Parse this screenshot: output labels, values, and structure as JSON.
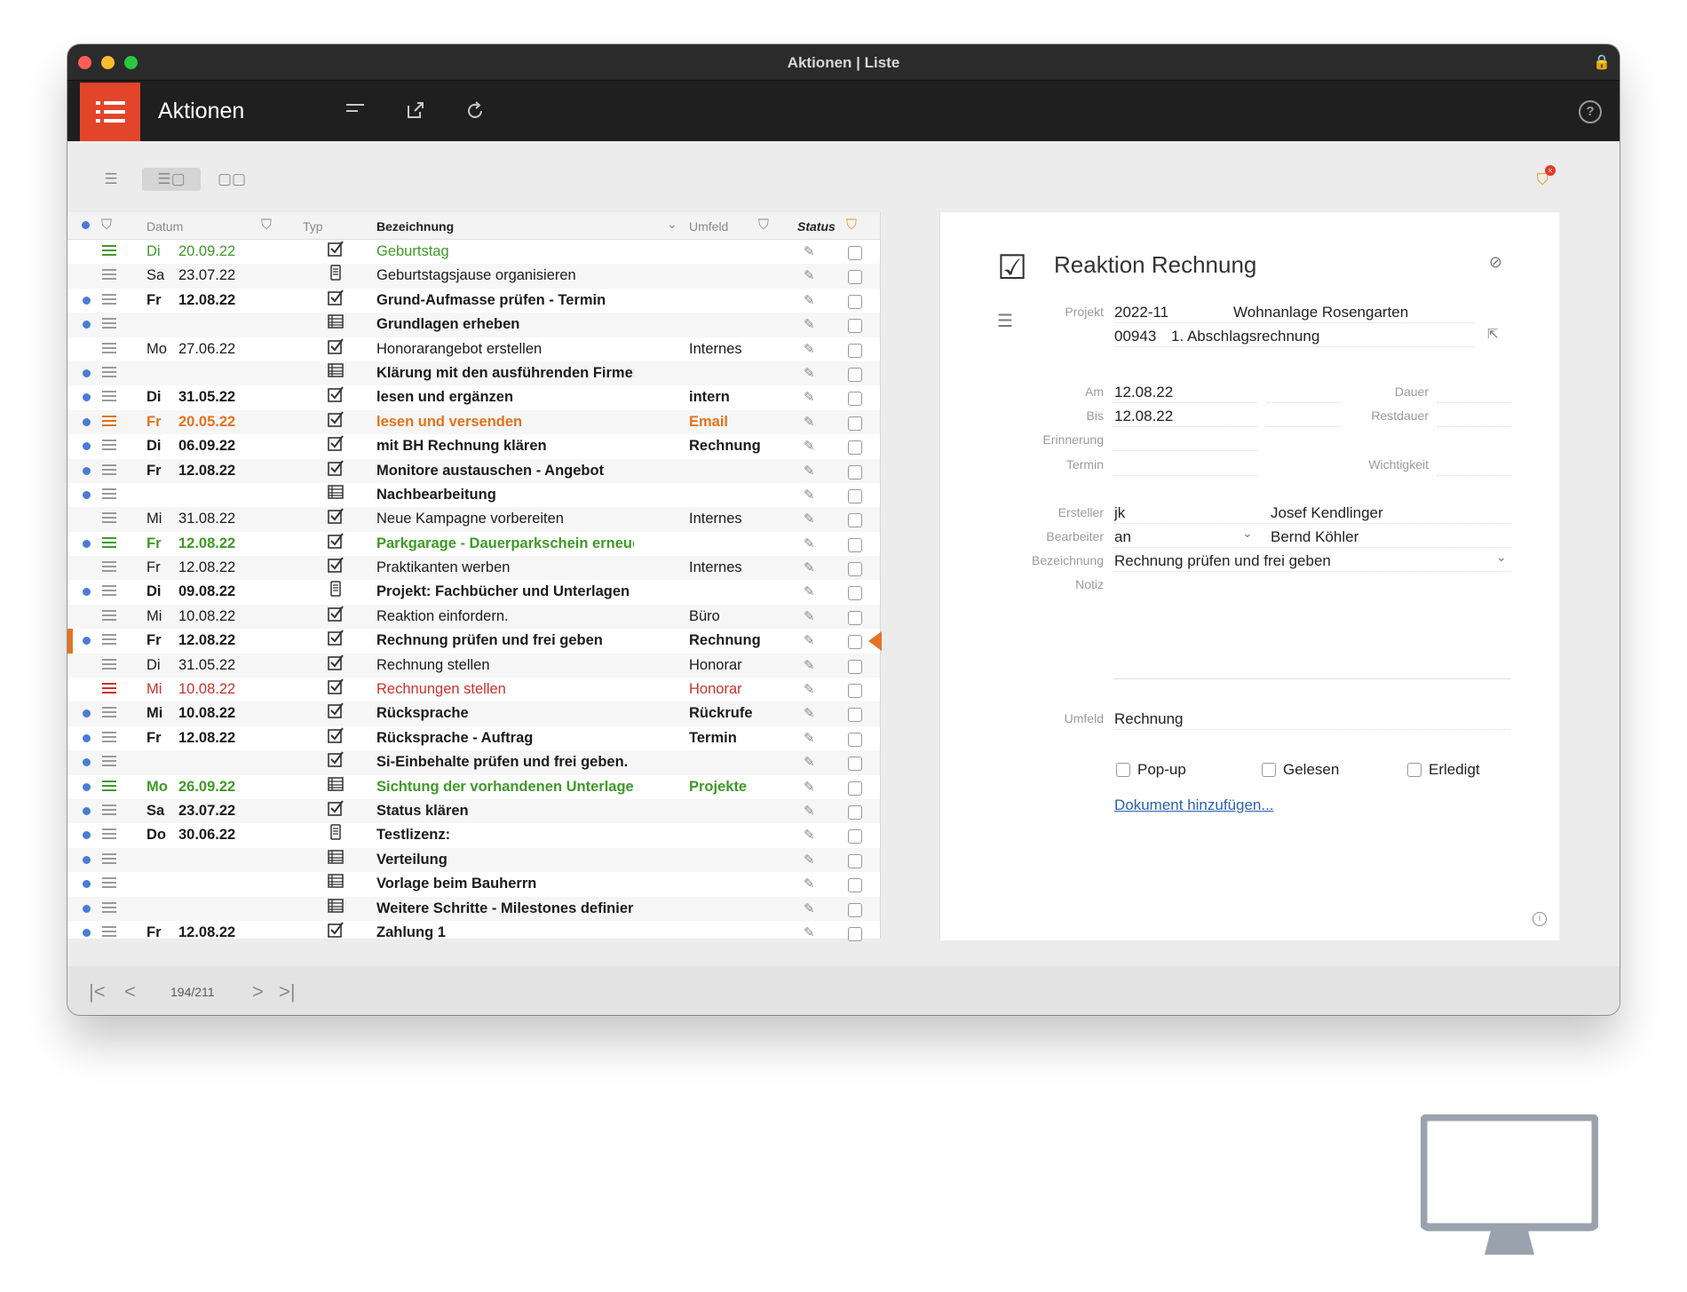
{
  "window": {
    "title": "Aktionen | Liste"
  },
  "toolbar": {
    "app_title": "Aktionen"
  },
  "list": {
    "headers": {
      "datum": "Datum",
      "typ": "Typ",
      "bezeichnung": "Bezeichnung",
      "umfeld": "Umfeld",
      "status": "Status"
    },
    "rows": [
      {
        "dot": false,
        "day": "Di",
        "date": "20.09.22",
        "type": "check",
        "name": "Geburtstag",
        "env": "",
        "style": "green",
        "menu": "green"
      },
      {
        "dot": false,
        "day": "Sa",
        "date": "23.07.22",
        "type": "doc",
        "name": "Geburtstagsjause organisieren",
        "env": "",
        "style": "normal",
        "menu": "gray"
      },
      {
        "dot": true,
        "day": "Fr",
        "date": "12.08.22",
        "type": "check",
        "name": "Grund-Aufmasse prüfen - Termin",
        "env": "",
        "style": "bold",
        "menu": "gray"
      },
      {
        "dot": true,
        "day": "",
        "date": "",
        "type": "list",
        "name": "Grundlagen erheben",
        "env": "",
        "style": "bold",
        "menu": "gray"
      },
      {
        "dot": false,
        "day": "Mo",
        "date": "27.06.22",
        "type": "check",
        "name": "Honorarangebot erstellen",
        "env": "Internes",
        "style": "normal",
        "menu": "gray"
      },
      {
        "dot": true,
        "day": "",
        "date": "",
        "type": "list",
        "name": "Klärung mit den ausführenden Firmen",
        "env": "",
        "style": "bold",
        "menu": "gray"
      },
      {
        "dot": true,
        "day": "Di",
        "date": "31.05.22",
        "type": "check",
        "name": "lesen und ergänzen",
        "env": "intern",
        "style": "bold",
        "menu": "gray"
      },
      {
        "dot": true,
        "day": "Fr",
        "date": "20.05.22",
        "type": "check",
        "name": "lesen und versenden",
        "env": "Email",
        "style": "orange",
        "menu": "orange"
      },
      {
        "dot": true,
        "day": "Di",
        "date": "06.09.22",
        "type": "check",
        "name": "mit BH Rechnung klären",
        "env": "Rechnung",
        "style": "bold",
        "menu": "gray"
      },
      {
        "dot": true,
        "day": "Fr",
        "date": "12.08.22",
        "type": "check",
        "name": "Monitore austauschen - Angebot",
        "env": "",
        "style": "bold",
        "menu": "gray"
      },
      {
        "dot": true,
        "day": "",
        "date": "",
        "type": "list",
        "name": "Nachbearbeitung",
        "env": "",
        "style": "bold",
        "menu": "gray"
      },
      {
        "dot": false,
        "day": "Mi",
        "date": "31.08.22",
        "type": "check",
        "name": "Neue Kampagne vorbereiten",
        "env": "Internes",
        "style": "normal",
        "menu": "gray"
      },
      {
        "dot": true,
        "day": "Fr",
        "date": "12.08.22",
        "type": "check",
        "name": "Parkgarage - Dauerparkschein erneuern",
        "env": "",
        "style": "green-bold",
        "menu": "green"
      },
      {
        "dot": false,
        "day": "Fr",
        "date": "12.08.22",
        "type": "check",
        "name": "Praktikanten werben",
        "env": "Internes",
        "style": "normal",
        "menu": "gray"
      },
      {
        "dot": true,
        "day": "Di",
        "date": "09.08.22",
        "type": "doc",
        "name": "Projekt: Fachbücher und Unterlagen vom",
        "env": "",
        "style": "bold",
        "menu": "gray"
      },
      {
        "dot": false,
        "day": "Mi",
        "date": "10.08.22",
        "type": "check",
        "name": "Reaktion einfordern.",
        "env": "Büro",
        "style": "normal",
        "menu": "gray"
      },
      {
        "dot": true,
        "day": "Fr",
        "date": "12.08.22",
        "type": "check",
        "name": "Rechnung prüfen und frei geben",
        "env": "Rechnung",
        "style": "semibold",
        "menu": "gray",
        "selected": true
      },
      {
        "dot": false,
        "day": "Di",
        "date": "31.05.22",
        "type": "check",
        "name": "Rechnung stellen",
        "env": "Honorar",
        "style": "normal",
        "menu": "gray"
      },
      {
        "dot": false,
        "day": "Mi",
        "date": "10.08.22",
        "type": "check",
        "name": "Rechnungen stellen",
        "env": "Honorar",
        "style": "red",
        "menu": "red"
      },
      {
        "dot": true,
        "day": "Mi",
        "date": "10.08.22",
        "type": "check",
        "name": "Rücksprache",
        "env": "Rückrufe",
        "style": "bold",
        "menu": "gray"
      },
      {
        "dot": true,
        "day": "Fr",
        "date": "12.08.22",
        "type": "check",
        "name": "Rücksprache - Auftrag",
        "env": "Termin",
        "style": "bold",
        "menu": "gray"
      },
      {
        "dot": true,
        "day": "",
        "date": "",
        "type": "check",
        "name": "Si-Einbehalte prüfen und frei geben.",
        "env": "",
        "style": "bold",
        "menu": "gray"
      },
      {
        "dot": true,
        "day": "Mo",
        "date": "26.09.22",
        "type": "list",
        "name": "Sichtung der vorhandenen Unterlagen",
        "env": "Projekte",
        "style": "green-bold",
        "menu": "green"
      },
      {
        "dot": true,
        "day": "Sa",
        "date": "23.07.22",
        "type": "check",
        "name": "Status klären",
        "env": "",
        "style": "bold",
        "menu": "gray"
      },
      {
        "dot": true,
        "day": "Do",
        "date": "30.06.22",
        "type": "doc",
        "name": "Testlizenz:",
        "env": "",
        "style": "bold",
        "menu": "gray"
      },
      {
        "dot": true,
        "day": "",
        "date": "",
        "type": "list",
        "name": "Verteilung",
        "env": "",
        "style": "bold",
        "menu": "gray"
      },
      {
        "dot": true,
        "day": "",
        "date": "",
        "type": "list",
        "name": "Vorlage beim Bauherrn",
        "env": "",
        "style": "bold",
        "menu": "gray"
      },
      {
        "dot": true,
        "day": "",
        "date": "",
        "type": "list",
        "name": "Weitere Schritte - Milestones definieren",
        "env": "",
        "style": "bold",
        "menu": "gray"
      },
      {
        "dot": true,
        "day": "Fr",
        "date": "12.08.22",
        "type": "check",
        "name": "Zahlung 1",
        "env": "",
        "style": "bold",
        "menu": "gray"
      }
    ]
  },
  "footer": {
    "page_text": "194/211"
  },
  "detail": {
    "title": "Reaktion Rechnung",
    "labels": {
      "projekt": "Projekt",
      "am": "Am",
      "bis": "Bis",
      "erinnerung": "Erinnerung",
      "termin": "Termin",
      "dauer": "Dauer",
      "restdauer": "Restdauer",
      "wichtigkeit": "Wichtigkeit",
      "ersteller": "Ersteller",
      "bearbeiter": "Bearbeiter",
      "bezeichnung": "Bezeichnung",
      "notiz": "Notiz",
      "umfeld": "Umfeld"
    },
    "values": {
      "projekt_nr": "2022-11",
      "projekt_name": "Wohnanlage Rosengarten",
      "rechnung_nr": "00943",
      "rechnung_name": "1. Abschlagsrechnung",
      "am": "12.08.22",
      "bis": "12.08.22",
      "ersteller_kurz": "jk",
      "ersteller_name": "Josef Kendlinger",
      "bearbeiter_kurz": "an",
      "bearbeiter_name": "Bernd Köhler",
      "bezeichnung": "Rechnung prüfen und frei geben",
      "umfeld": "Rechnung"
    },
    "checkboxes": {
      "popup": "Pop-up",
      "gelesen": "Gelesen",
      "erledigt": "Erledigt"
    },
    "doc_link": "Dokument hinzufügen..."
  },
  "colors": {
    "accent": "#e2452a",
    "selection": "#e37424",
    "green": "#3e9a26",
    "red": "#c8312b",
    "dot": "#4a7bd6"
  }
}
